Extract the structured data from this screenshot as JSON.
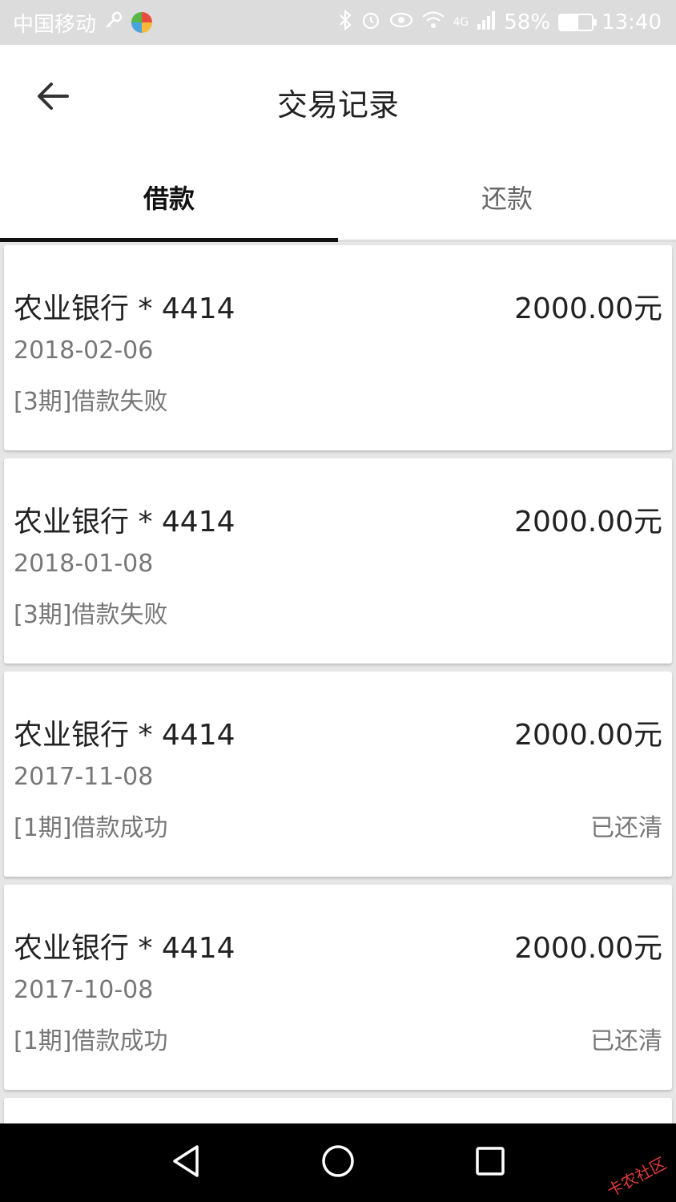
{
  "status_bar": {
    "carrier": "中国移动",
    "network": "4G",
    "battery": "58%",
    "battery_level": 0.58,
    "time": "13:40"
  },
  "header": {
    "title": "交易记录",
    "back_icon": "arrow-left-icon"
  },
  "tabs": [
    {
      "label": "借款",
      "active": true
    },
    {
      "label": "还款",
      "active": false
    }
  ],
  "records": [
    {
      "bank": "农业银行 * 4414",
      "amount": "2000.00元",
      "date": "2018-02-06",
      "status": "[3期]借款失败",
      "repaid": ""
    },
    {
      "bank": "农业银行 * 4414",
      "amount": "2000.00元",
      "date": "2018-01-08",
      "status": "[3期]借款失败",
      "repaid": ""
    },
    {
      "bank": "农业银行 * 4414",
      "amount": "2000.00元",
      "date": "2017-11-08",
      "status": "[1期]借款成功",
      "repaid": "已还清"
    },
    {
      "bank": "农业银行 * 4414",
      "amount": "2000.00元",
      "date": "2017-10-08",
      "status": "[1期]借款成功",
      "repaid": "已还清"
    }
  ],
  "nav": {
    "back_icon": "triangle-back-icon",
    "home_icon": "circle-home-icon",
    "recents_icon": "square-recents-icon"
  },
  "watermark": "卡农社区",
  "colors": {
    "status_bar_bg": "#dcdcdc",
    "page_bg": "#e6e6e6",
    "card_bg": "#ffffff",
    "tab_indicator": "#111111",
    "nav_bg": "#000000"
  }
}
